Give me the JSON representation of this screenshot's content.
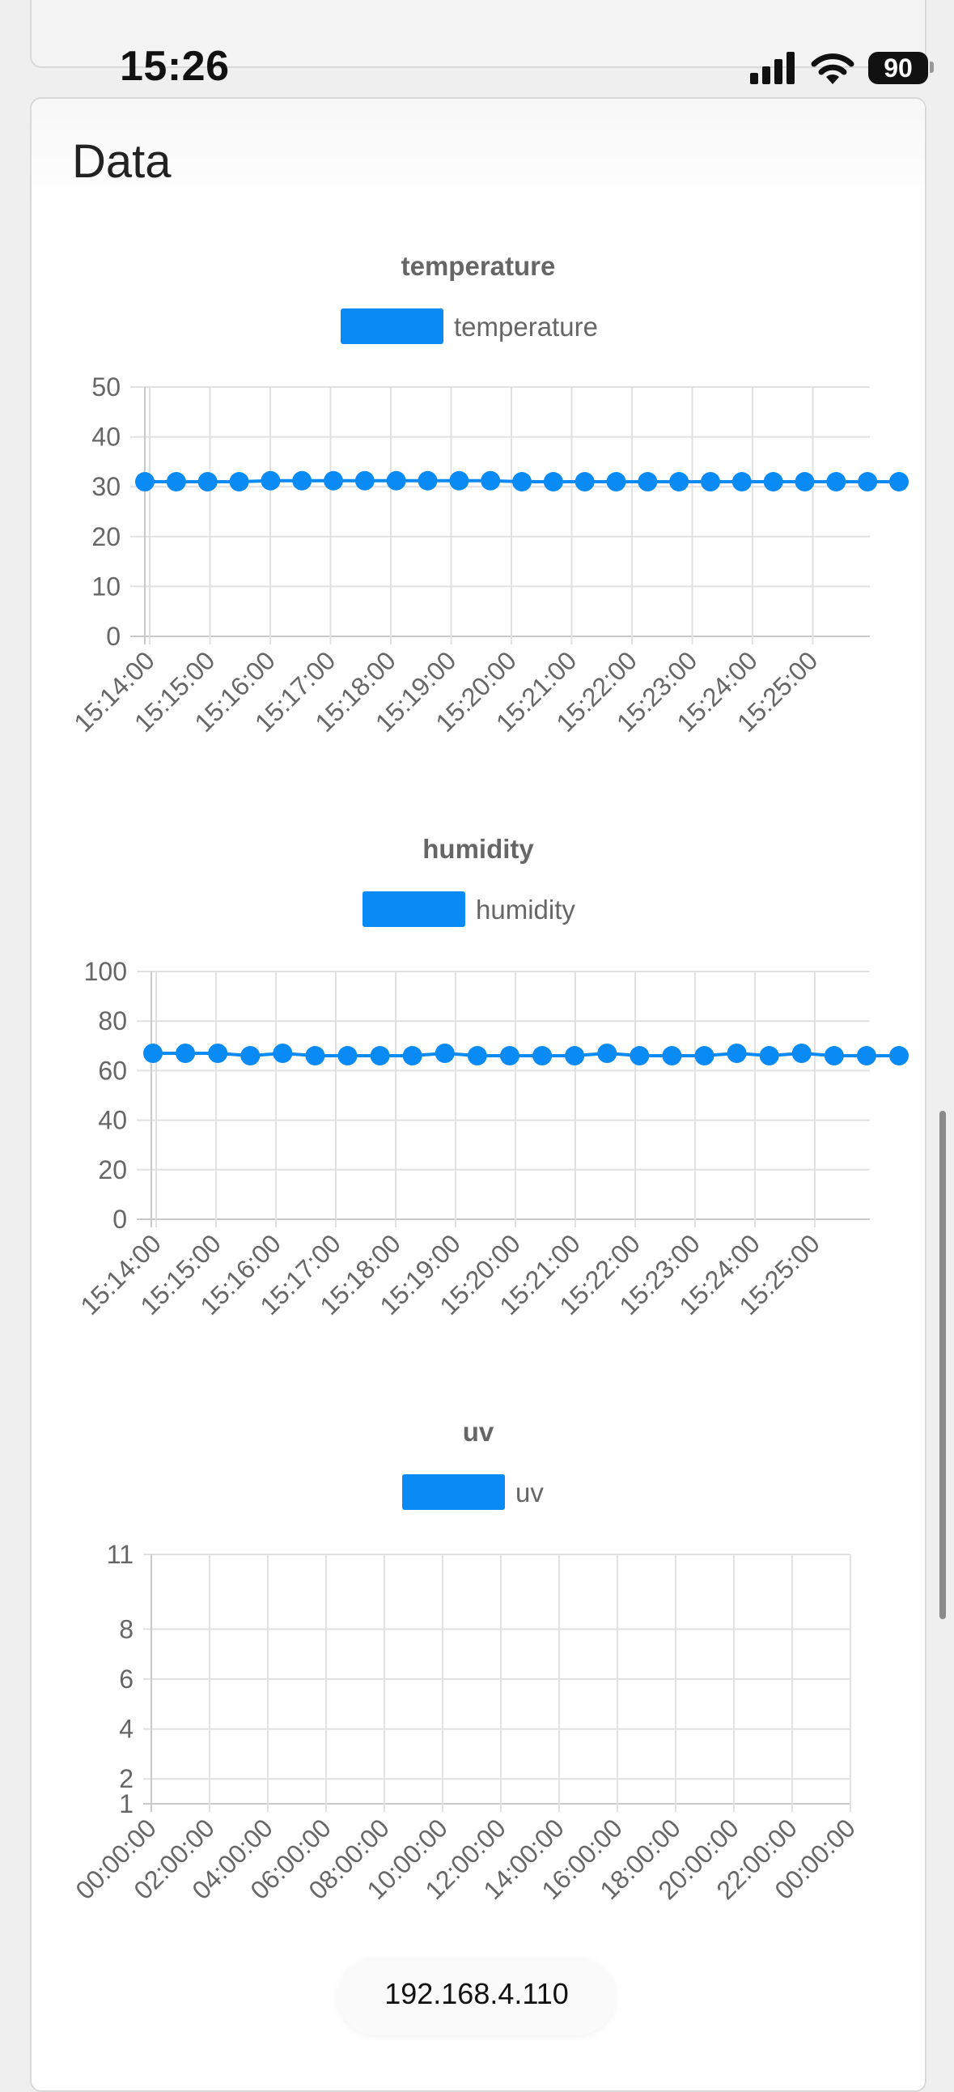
{
  "status_bar": {
    "time": "15:26",
    "battery": "90"
  },
  "card": {
    "title": "Data"
  },
  "footer": {
    "url": "192.168.4.110"
  },
  "colors": {
    "series": "#0a8af4",
    "grid": "#e1e1e1",
    "text": "#666666"
  },
  "icons": [
    "signal-icon",
    "wifi-icon",
    "battery-icon"
  ],
  "chart_data": [
    {
      "type": "line",
      "title": "temperature",
      "grid": true,
      "legend": "top",
      "series": [
        {
          "name": "temperature",
          "values": [
            31,
            31,
            31,
            31,
            31.2,
            31.2,
            31.2,
            31.2,
            31.2,
            31.2,
            31.2,
            31.2,
            31,
            31,
            31,
            31,
            31,
            31,
            31,
            31,
            31,
            31,
            31,
            31,
            31
          ]
        }
      ],
      "x_tick_labels": [
        "15:14:00",
        "15:15:00",
        "15:16:00",
        "15:17:00",
        "15:18:00",
        "15:19:00",
        "15:20:00",
        "15:21:00",
        "15:22:00",
        "15:23:00",
        "15:24:00",
        "15:25:00"
      ],
      "y_ticks": [
        "0",
        "10",
        "20",
        "30",
        "40",
        "50"
      ],
      "ylim": [
        0,
        50
      ]
    },
    {
      "type": "line",
      "title": "humidity",
      "grid": true,
      "legend": "top",
      "series": [
        {
          "name": "humidity",
          "values": [
            67,
            67,
            67,
            66,
            67,
            66,
            66,
            66,
            66,
            67,
            66,
            66,
            66,
            66,
            67,
            66,
            66,
            66,
            67,
            66,
            67,
            66,
            66,
            66
          ]
        }
      ],
      "x_tick_labels": [
        "15:14:00",
        "15:15:00",
        "15:16:00",
        "15:17:00",
        "15:18:00",
        "15:19:00",
        "15:20:00",
        "15:21:00",
        "15:22:00",
        "15:23:00",
        "15:24:00",
        "15:25:00"
      ],
      "y_ticks": [
        "0",
        "20",
        "40",
        "60",
        "80",
        "100"
      ],
      "ylim": [
        0,
        100
      ]
    },
    {
      "type": "line",
      "title": "uv",
      "grid": true,
      "legend": "top",
      "series": [
        {
          "name": "uv",
          "values": []
        }
      ],
      "x_tick_labels": [
        "00:00:00",
        "02:00:00",
        "04:00:00",
        "06:00:00",
        "08:00:00",
        "10:00:00",
        "12:00:00",
        "14:00:00",
        "16:00:00",
        "18:00:00",
        "20:00:00",
        "22:00:00",
        "00:00:00"
      ],
      "y_ticks": [
        "1",
        "2",
        "4",
        "6",
        "8",
        "11"
      ],
      "ylim": [
        1,
        11
      ]
    }
  ]
}
